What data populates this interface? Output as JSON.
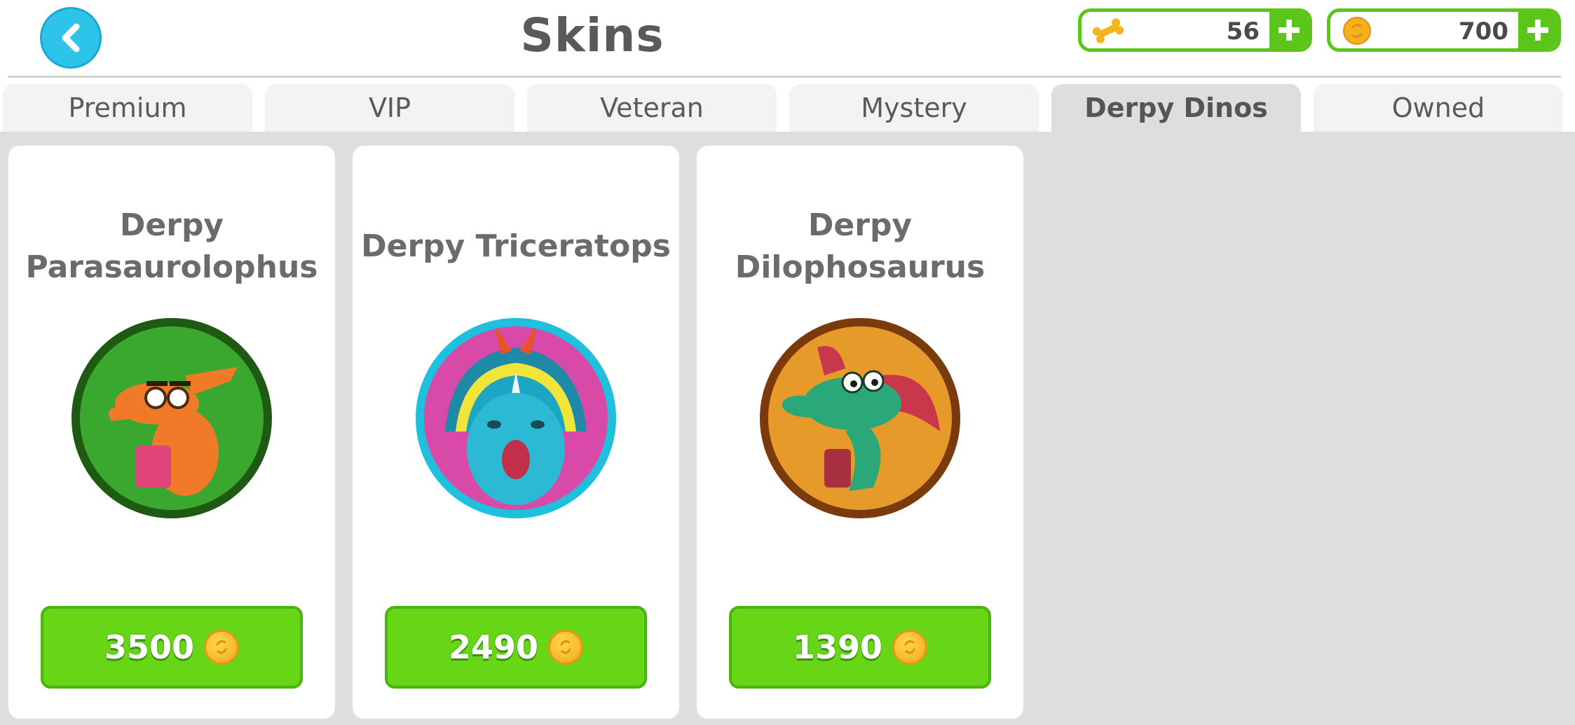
{
  "header": {
    "title": "Skins",
    "back_icon": "chevron-left-icon",
    "currencies": [
      {
        "name": "bones",
        "icon": "bone-icon",
        "value": "56"
      },
      {
        "name": "coins",
        "icon": "coin-icon",
        "value": "700"
      }
    ]
  },
  "tabs": [
    {
      "label": "Premium",
      "active": false
    },
    {
      "label": "VIP",
      "active": false
    },
    {
      "label": "Veteran",
      "active": false
    },
    {
      "label": "Mystery",
      "active": false
    },
    {
      "label": "Derpy Dinos",
      "active": true
    },
    {
      "label": "Owned",
      "active": false
    }
  ],
  "skins": [
    {
      "title_line1": "Derpy",
      "title_line2": "Parasaurolophus",
      "price": "3500",
      "ring_color": "#1f5a12",
      "bg_color": "#2f9a25"
    },
    {
      "title_line1": "Derpy Triceratops",
      "price": "2490",
      "ring_color": "#1ec0de",
      "bg_color": "#d63fa8"
    },
    {
      "title_line1": "Derpy",
      "title_line2": "Dilophosaurus",
      "price": "1390",
      "ring_color": "#7a3a0c",
      "bg_color": "#e08a1c"
    }
  ],
  "colors": {
    "accent_green": "#66d617",
    "back_button": "#2ec4ea",
    "active_tab": "#dedede"
  }
}
